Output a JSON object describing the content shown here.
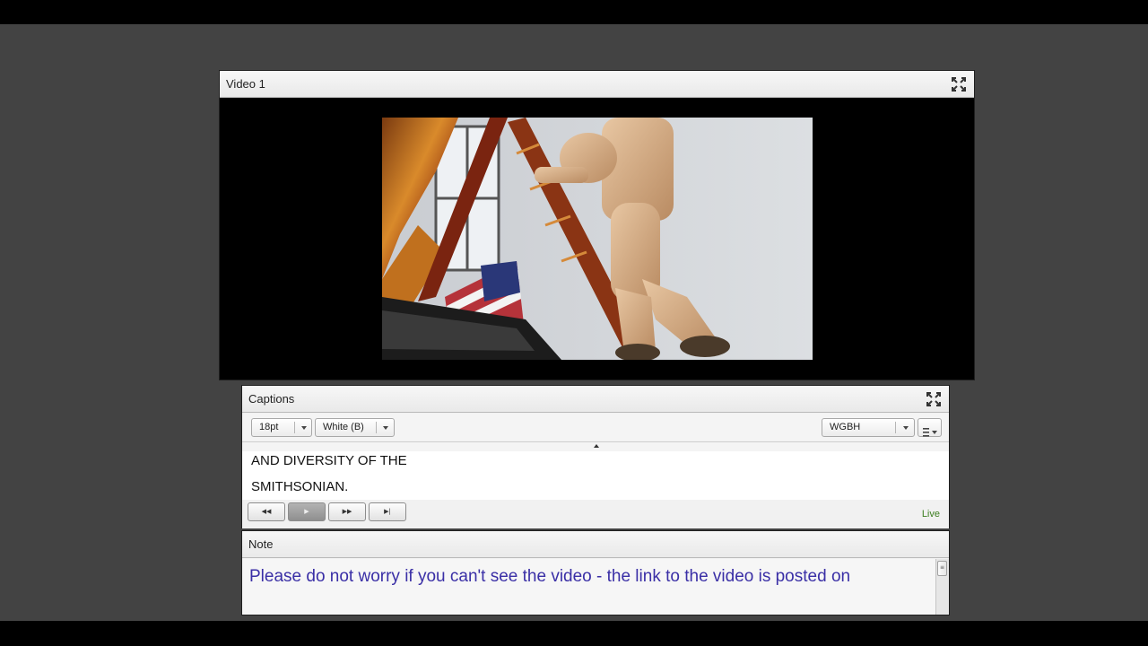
{
  "video_pod": {
    "title": "Video 1",
    "maximize_icon": "fullscreen-icon"
  },
  "captions_pod": {
    "title": "Captions",
    "maximize_icon": "fullscreen-icon",
    "font_size": {
      "selected": "18pt"
    },
    "color": {
      "selected": "White (B)"
    },
    "provider": {
      "selected": "WGBH"
    },
    "menu_icon": "list-menu-icon",
    "lines": [
      "AND DIVERSITY OF THE",
      "SMITHSONIAN."
    ],
    "controls": {
      "rewind_icon": "rewind-icon",
      "play_icon": "play-icon",
      "fast_forward_icon": "fast-forward-icon",
      "skip_end_icon": "skip-to-end-icon"
    },
    "status": "Live"
  },
  "note_pod": {
    "title": "Note",
    "text": "Please do not worry if you can't see the video - the link to the video is posted on"
  },
  "colors": {
    "background": "#434343",
    "note_text": "#3a2fa6",
    "live_text": "#3b7d1e"
  }
}
